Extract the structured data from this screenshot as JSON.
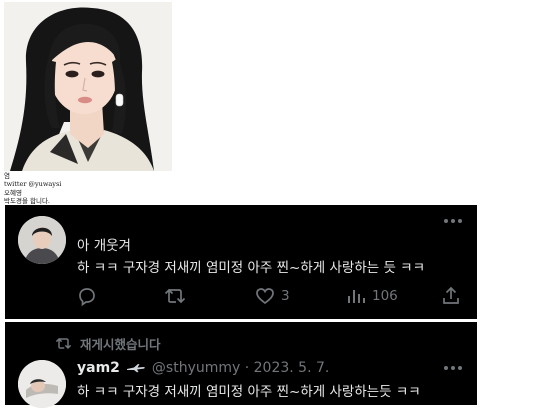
{
  "profile": {
    "lines": [
      "염",
      "twitter @yuwaysi",
      "오혜영",
      "박도경을 합니다."
    ]
  },
  "tweet1": {
    "line1": "아 개웃겨",
    "line2": "하 ㅋㅋ 구자경 저새끼 염미정 아주 찐~하게 사랑하는 듯 ㅋㅋ",
    "likes": "3",
    "views": "106"
  },
  "tweet2": {
    "retweet_label": "재게시했습니다",
    "display_name": "yam2",
    "handle_date": "@sthyummy · 2023. 5. 7.",
    "text": "하 ㅋㅋ 구자경 저새끼 염미정 아주 찐~하게 사랑하는듯 ㅋㅋ"
  },
  "colors": {
    "background": "#000000",
    "text": "#e7e9ea",
    "muted": "#71767b"
  }
}
